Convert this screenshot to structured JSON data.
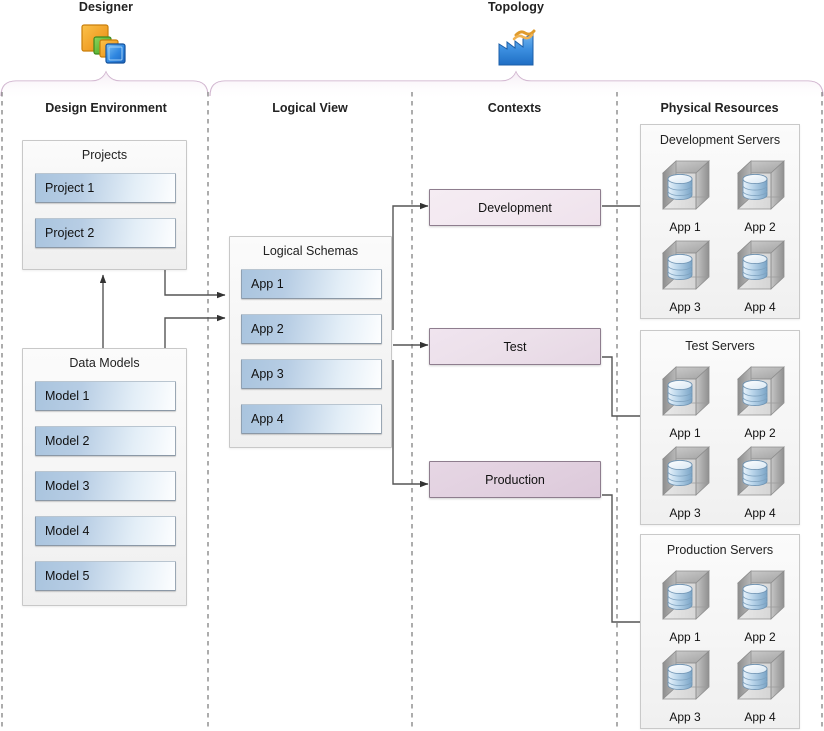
{
  "roles": [
    {
      "name": "designer",
      "title": "Designer",
      "icon": "stacked-squares-icon"
    },
    {
      "name": "topology",
      "title": "Topology",
      "icon": "factory-icon"
    }
  ],
  "columns": [
    {
      "name": "design-environment",
      "title": "Design Environment"
    },
    {
      "name": "logical-view",
      "title": "Logical View"
    },
    {
      "name": "contexts",
      "title": "Contexts"
    },
    {
      "name": "physical-resources",
      "title": "Physical Resources"
    }
  ],
  "design_environment": {
    "projects": {
      "title": "Projects",
      "items": [
        "Project 1",
        "Project 2"
      ]
    },
    "data_models": {
      "title": "Data Models",
      "items": [
        "Model 1",
        "Model 2",
        "Model 3",
        "Model 4",
        "Model 5"
      ]
    }
  },
  "logical_view": {
    "logical_schemas": {
      "title": "Logical Schemas",
      "items": [
        "App 1",
        "App 2",
        "App 3",
        "App 4"
      ]
    }
  },
  "contexts": {
    "items": [
      {
        "label": "Development",
        "tone": "light"
      },
      {
        "label": "Test",
        "tone": "mid"
      },
      {
        "label": "Production",
        "tone": "deep"
      }
    ]
  },
  "physical_resources": {
    "groups": [
      {
        "title": "Development Servers",
        "servers": [
          "App 1",
          "App 2",
          "App 3",
          "App 4"
        ]
      },
      {
        "title": "Test Servers",
        "servers": [
          "App 1",
          "App 2",
          "App 3",
          "App 4"
        ]
      },
      {
        "title": "Production Servers",
        "servers": [
          "App 1",
          "App 2",
          "App 3",
          "App 4"
        ]
      }
    ]
  },
  "colors": {
    "bracket": "#c9a9c7",
    "divider": "#8a8a8a",
    "connector": "#4d4d4d",
    "item_blue": "#b7cde4",
    "context_lavender": "#e6d6e4",
    "panel_bg": "#f4f4f4",
    "server_body": "#9a9a9a",
    "database_blue": "#9bbdd8"
  }
}
